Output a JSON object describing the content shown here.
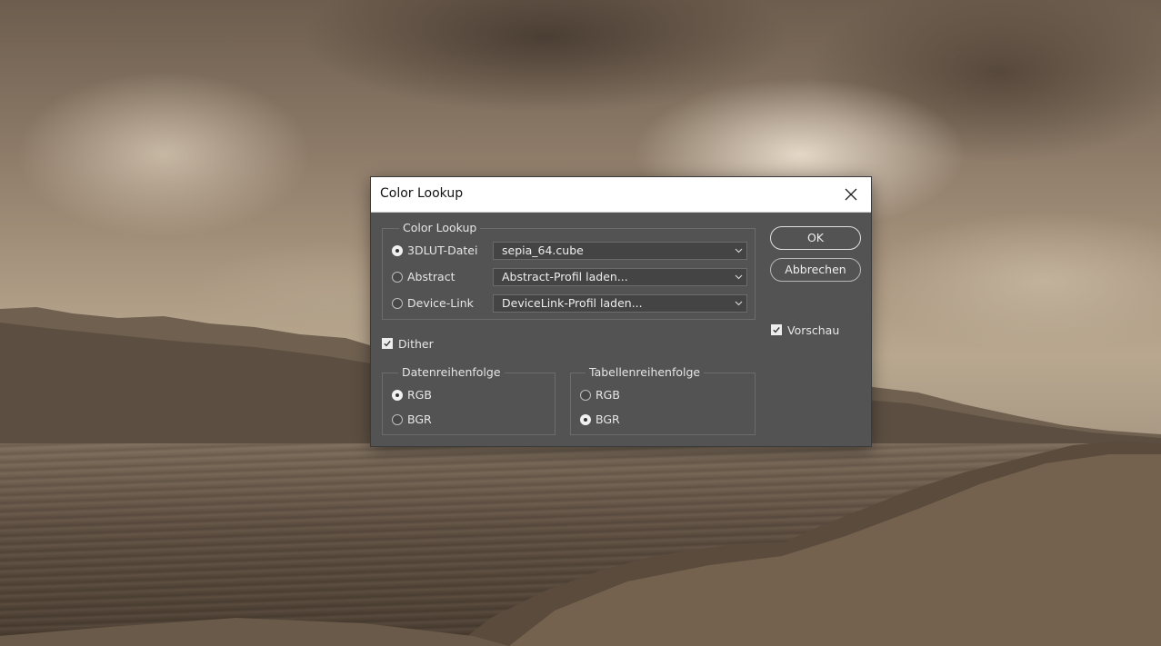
{
  "dialog": {
    "title": "Color Lookup",
    "close_icon": "close-icon"
  },
  "color_lookup": {
    "legend": "Color Lookup",
    "options": [
      {
        "label": "3DLUT-Datei",
        "selected": true,
        "dropdown_value": "sepia_64.cube"
      },
      {
        "label": "Abstract",
        "selected": false,
        "dropdown_value": "Abstract-Profil laden..."
      },
      {
        "label": "Device-Link",
        "selected": false,
        "dropdown_value": "DeviceLink-Profil laden..."
      }
    ]
  },
  "dither": {
    "label": "Dither",
    "checked": true
  },
  "data_order": {
    "legend": "Datenreihenfolge",
    "options": [
      {
        "label": "RGB",
        "selected": true
      },
      {
        "label": "BGR",
        "selected": false
      }
    ]
  },
  "table_order": {
    "legend": "Tabellenreihenfolge",
    "options": [
      {
        "label": "RGB",
        "selected": false
      },
      {
        "label": "BGR",
        "selected": true
      }
    ]
  },
  "buttons": {
    "ok": "OK",
    "cancel": "Abbrechen"
  },
  "preview": {
    "label": "Vorschau",
    "checked": true
  },
  "colors": {
    "dialog_bg": "#535353",
    "titlebar_bg": "#ffffff",
    "text": "#e6e6e6"
  }
}
